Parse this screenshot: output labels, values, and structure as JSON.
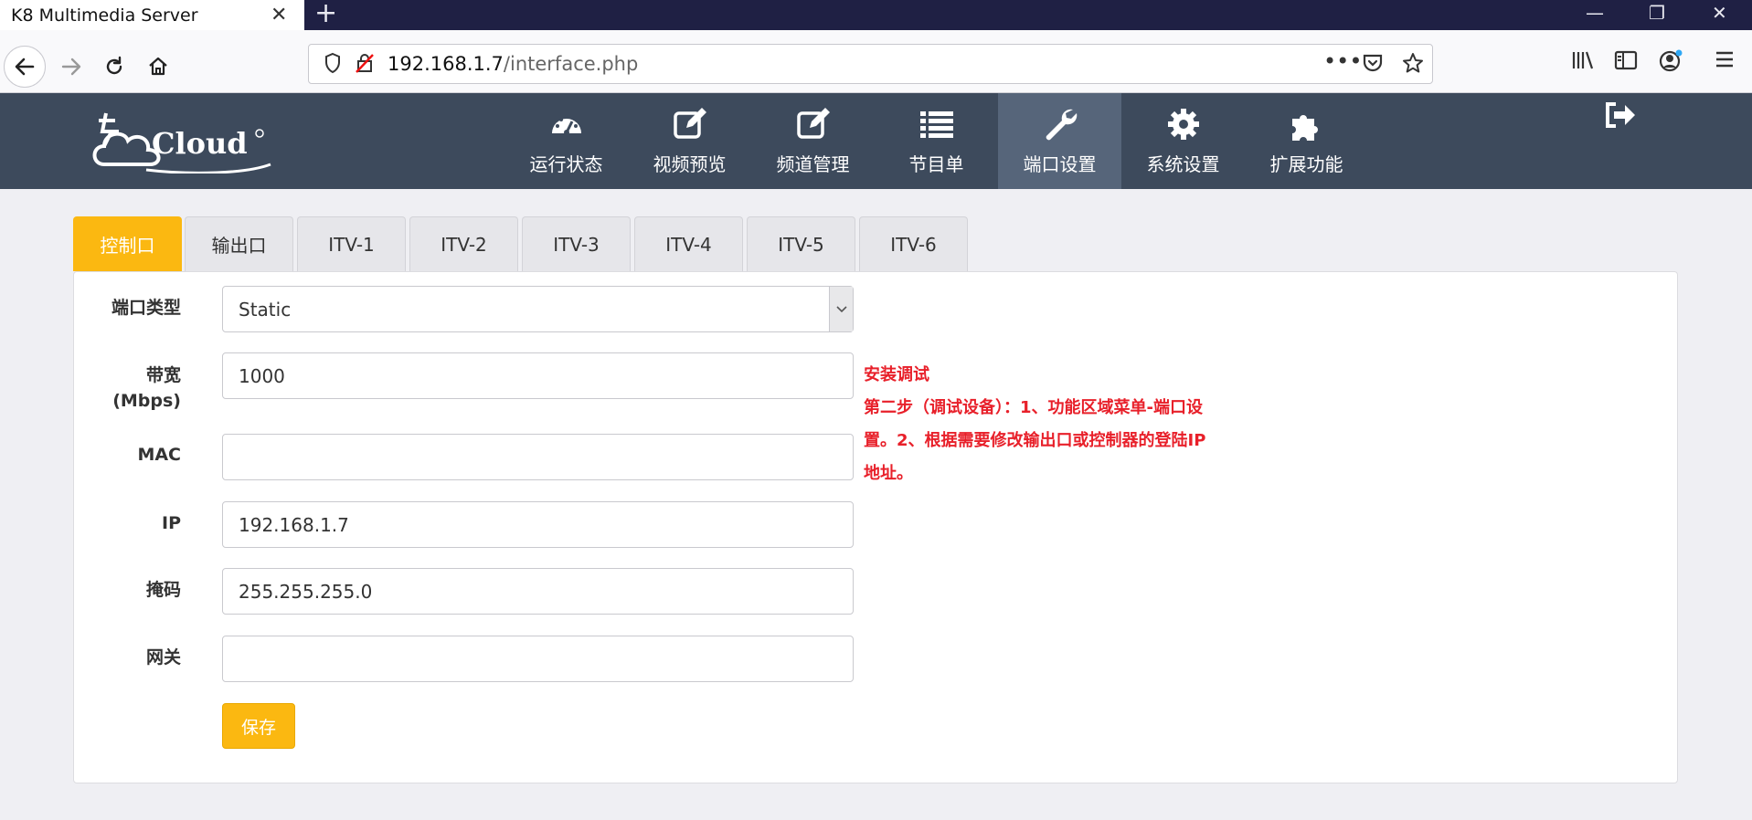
{
  "browser": {
    "tab_title": "K8 Multimedia Server",
    "url_host": "192.168.1.7",
    "url_path": "/interface.php"
  },
  "app": {
    "logo_text": "Cloud",
    "menu": [
      {
        "label": "运行状态",
        "icon": "dashboard-icon"
      },
      {
        "label": "视频预览",
        "icon": "edit-icon"
      },
      {
        "label": "频道管理",
        "icon": "edit-icon"
      },
      {
        "label": "节目单",
        "icon": "list-icon"
      },
      {
        "label": "端口设置",
        "icon": "wrench-icon",
        "active": true
      },
      {
        "label": "系统设置",
        "icon": "gear-icon"
      },
      {
        "label": "扩展功能",
        "icon": "puzzle-icon"
      }
    ]
  },
  "subtabs": [
    "控制口",
    "输出口",
    "ITV-1",
    "ITV-2",
    "ITV-3",
    "ITV-4",
    "ITV-5",
    "ITV-6"
  ],
  "form": {
    "port_type_label": "端口类型",
    "port_type_value": "Static",
    "bandwidth_label_1": "带宽",
    "bandwidth_label_2": "(Mbps)",
    "bandwidth_value": "1000",
    "mac_label": "MAC",
    "mac_value": "",
    "ip_label": "IP",
    "ip_value": "192.168.1.7",
    "mask_label": "掩码",
    "mask_value": "255.255.255.0",
    "gateway_label": "网关",
    "gateway_value": "",
    "save_label": "保存"
  },
  "note": {
    "line1": "安装调试",
    "line2": "第二步（调试设备）：1、功能区域菜单-端口设",
    "line3": "置。2、根据需要修改输出口或控制器的登陆IP",
    "line4": "地址。"
  },
  "colors": {
    "accent": "#fbb811",
    "header": "#3d4a5c",
    "header_active": "#56657a",
    "note_red": "#e8202a"
  }
}
